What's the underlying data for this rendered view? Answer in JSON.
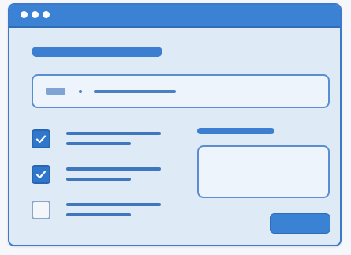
{
  "colors": {
    "accent": "#3b82d4",
    "frame_border": "#3f7ac8",
    "window_background": "#dfeaf7",
    "field_background": "#eef4fb",
    "placeholder_line": "#3f77bf",
    "checkbox_checked": "#2f77cc",
    "checkbox_unchecked": "#f3f6fb"
  },
  "window": {
    "titlebar_controls": [
      "window-dot",
      "window-dot",
      "window-dot"
    ]
  },
  "form": {
    "checklist": [
      {
        "checked": true
      },
      {
        "checked": true
      },
      {
        "checked": false
      }
    ]
  },
  "icons": {
    "checkmark": "checkmark-icon"
  }
}
